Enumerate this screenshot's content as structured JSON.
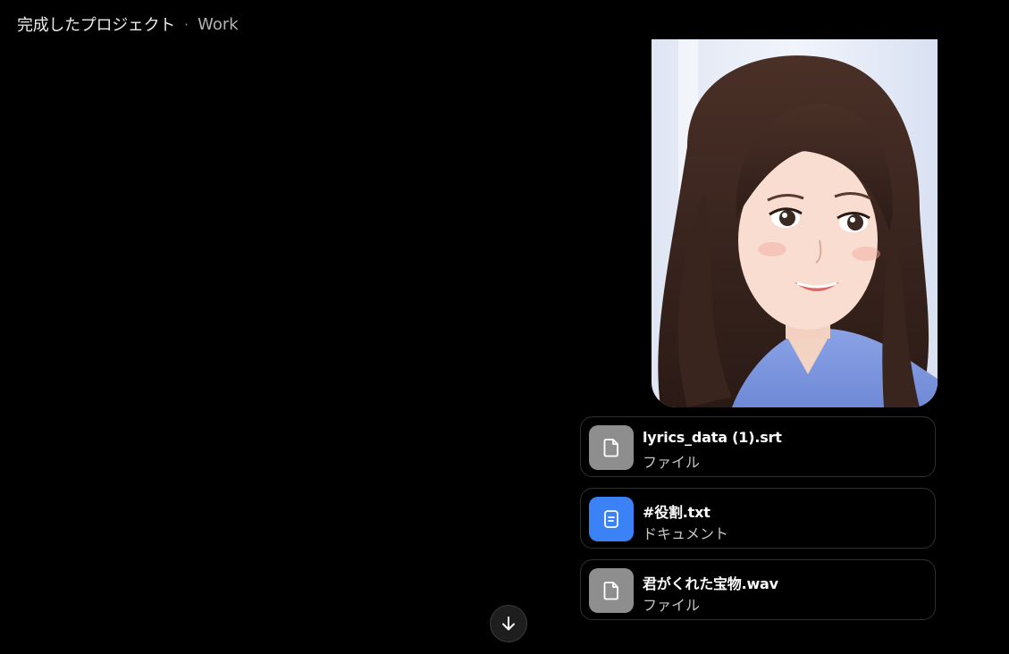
{
  "header": {
    "project": "完成したプロジェクト",
    "separator": "·",
    "workspace": "Work"
  },
  "image": {
    "description_icon": "portrait-illustration"
  },
  "attachments": [
    {
      "name": "lyrics_data (1).srt",
      "type": "ファイル",
      "icon": "file-icon",
      "color": "#8e8e8e"
    },
    {
      "name": "#役割.txt",
      "type": "ドキュメント",
      "icon": "document-icon",
      "color": "#3b82f6"
    },
    {
      "name": "君がくれた宝物.wav",
      "type": "ファイル",
      "icon": "file-icon",
      "color": "#8e8e8e"
    }
  ],
  "scroll_button": {
    "icon": "arrow-down-icon"
  }
}
